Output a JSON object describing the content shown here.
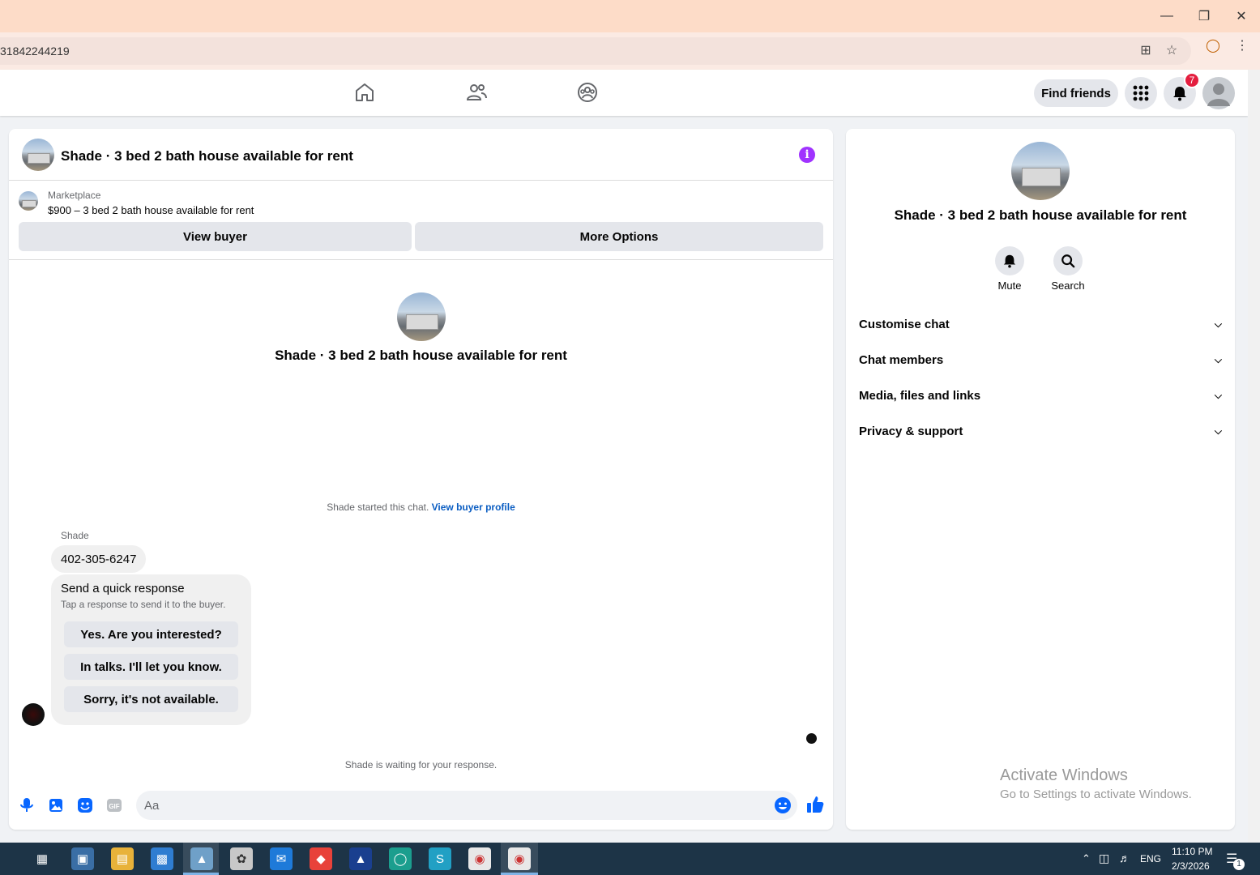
{
  "browser": {
    "url": "31842244219",
    "window_controls": [
      "minimize",
      "restore",
      "close"
    ]
  },
  "header": {
    "find_friends": "Find friends",
    "notification_count": "7"
  },
  "chat": {
    "title": "Shade · 3 bed 2 bath house available for rent",
    "marketplace_label": "Marketplace",
    "marketplace_item": "$900 – 3 bed 2 bath house available for rent",
    "view_buyer": "View buyer",
    "more_options": "More Options",
    "center_title": "Shade · 3 bed 2 bath house available for rent",
    "started_text": "Shade started this chat.",
    "view_buyer_profile": "View buyer profile",
    "sender_name": "Shade",
    "message": "402-305-6247",
    "quick_response": {
      "title": "Send a quick response",
      "subtitle": "Tap a response to send it to the buyer.",
      "options": [
        "Yes. Are you interested?",
        "In talks. I'll let you know.",
        "Sorry, it's not available."
      ]
    },
    "waiting_text": "Shade is waiting for your response.",
    "compose_placeholder": "Aa"
  },
  "sidebar": {
    "title": "Shade · 3 bed 2 bath house available for rent",
    "actions": [
      {
        "label": "Mute",
        "icon": "bell-icon"
      },
      {
        "label": "Search",
        "icon": "search-icon"
      }
    ],
    "sections": [
      "Customise chat",
      "Chat members",
      "Media, files and links",
      "Privacy & support"
    ]
  },
  "watermark": {
    "line1": "Activate Windows",
    "line2": "Go to Settings to activate Windows."
  },
  "taskbar": {
    "time": "11:10 PM",
    "date": "2/3/2026",
    "language": "ENG",
    "notification_count": "1"
  },
  "colors": {
    "titlebar": "#fddcc8",
    "accent_blue": "#0866ff",
    "info_purple": "#a033ff",
    "badge_red": "#e41e3f"
  }
}
